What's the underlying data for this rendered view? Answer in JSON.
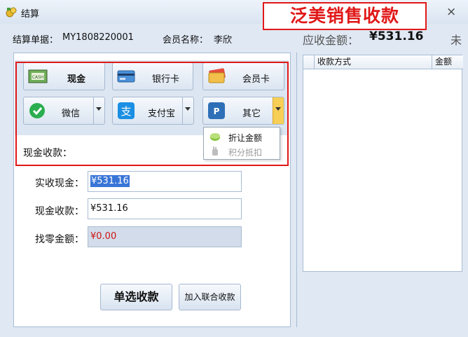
{
  "window": {
    "title": "结算",
    "close": "×"
  },
  "banner": "泛美销售收款",
  "info": {
    "order_label": "结算单据：",
    "order_no": "MY1808220001",
    "member_label": "会员名称：",
    "member_name": "李欣",
    "due_label": "应收金额：",
    "due_value": "¥531.16",
    "cut_text": "未"
  },
  "pay_methods": {
    "cash": "现金",
    "bank": "银行卡",
    "member": "会员卡",
    "wechat": "微信",
    "alipay": "支付宝",
    "other": "其它"
  },
  "other_menu": [
    {
      "label": "折让金额",
      "enabled": true
    },
    {
      "label": "积分抵扣",
      "enabled": false
    }
  ],
  "cash_section": {
    "title": "现金收款：",
    "actual_label": "实收现金：",
    "actual_value": "¥531.16",
    "cash_label": "现金收款：",
    "cash_value": "¥531.16",
    "change_label": "找零金额：",
    "change_value": "¥0.00"
  },
  "actions": {
    "single": "单选收款",
    "joint": "加入联合收款"
  },
  "grid": {
    "columns": [
      "收款方式",
      "金额"
    ]
  },
  "colors": {
    "accent_red": "#e11818",
    "selected_arrow": "#f7cf57"
  }
}
